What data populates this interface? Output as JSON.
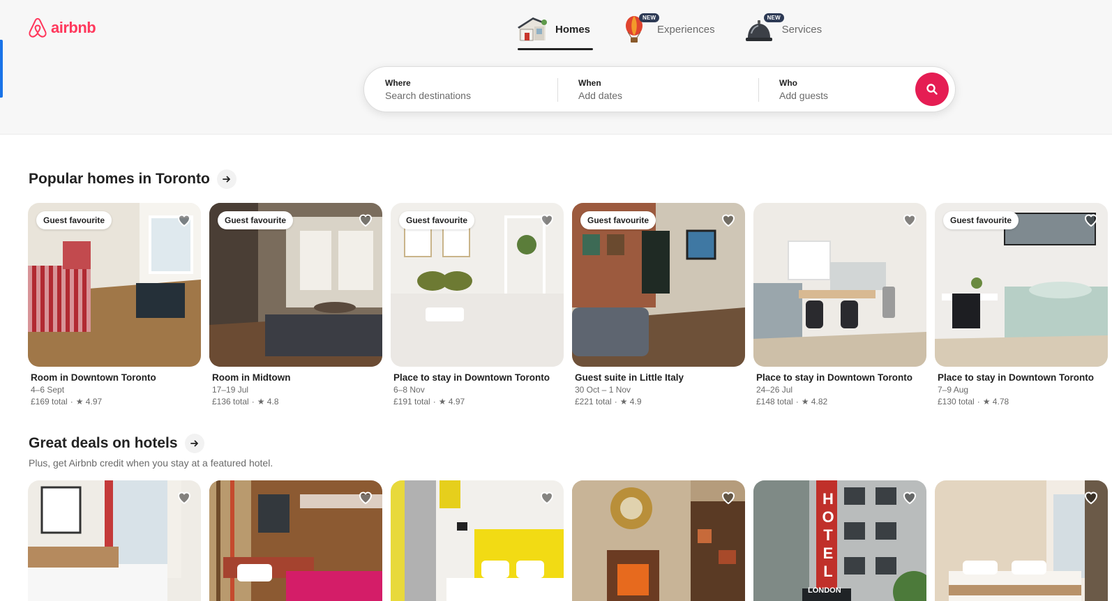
{
  "brand": {
    "name": "airbnb",
    "color": "#ff385c"
  },
  "nav": {
    "items": [
      {
        "label": "Homes",
        "icon": "house-icon",
        "active": true,
        "badge": ""
      },
      {
        "label": "Experiences",
        "icon": "hot-air-balloon-icon",
        "active": false,
        "badge": "NEW"
      },
      {
        "label": "Services",
        "icon": "service-bell-icon",
        "active": false,
        "badge": "NEW"
      }
    ]
  },
  "search": {
    "where_label": "Where",
    "where_placeholder": "Search destinations",
    "when_label": "When",
    "when_placeholder": "Add dates",
    "who_label": "Who",
    "who_placeholder": "Add guests",
    "button_icon": "search-icon",
    "button_color": "#e51d53"
  },
  "sections": {
    "popular": {
      "title": "Popular homes in Toronto",
      "listings": [
        {
          "badge": "Guest favourite",
          "title": "Room in Downtown Toronto",
          "dates": "4–6 Sept",
          "price": "£169 total",
          "rating": "★ 4.97"
        },
        {
          "badge": "Guest favourite",
          "title": "Room in Midtown",
          "dates": "17–19 Jul",
          "price": "£136 total",
          "rating": "★ 4.8"
        },
        {
          "badge": "Guest favourite",
          "title": "Place to stay in Downtown Toronto",
          "dates": "6–8 Nov",
          "price": "£191 total",
          "rating": "★ 4.97"
        },
        {
          "badge": "Guest favourite",
          "title": "Guest suite in Little Italy",
          "dates": "30 Oct – 1 Nov",
          "price": "£221 total",
          "rating": "★ 4.9"
        },
        {
          "badge": "",
          "title": "Place to stay in Downtown Toronto",
          "dates": "24–26 Jul",
          "price": "£148 total",
          "rating": "★ 4.82"
        },
        {
          "badge": "Guest favourite",
          "title": "Place to stay in Downtown Toronto",
          "dates": "7–9 Aug",
          "price": "£130 total",
          "rating": "★ 4.78"
        }
      ]
    },
    "hotels": {
      "title": "Great deals on hotels",
      "subtitle": "Plus, get Airbnb credit when you stay at a featured hotel.",
      "hotel_sign": "HOTEL",
      "hotel_sign_sub": "LONDON"
    }
  }
}
